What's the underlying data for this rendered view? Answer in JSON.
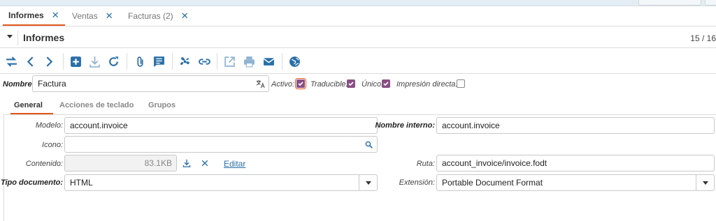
{
  "tabs": [
    {
      "label": "Informes",
      "active": true
    },
    {
      "label": "Ventas",
      "active": false
    },
    {
      "label": "Facturas (2)",
      "active": false
    }
  ],
  "titlebar": {
    "title": "Informes",
    "record_count": "15 / 16"
  },
  "toolbar": {
    "icons": [
      "switch-view-icon",
      "previous-icon",
      "next-icon",
      "new-record-icon",
      "save-icon",
      "reload-icon",
      "attachment-icon",
      "note-icon",
      "action-icon",
      "relate-icon",
      "open-external-icon",
      "print-icon",
      "email-icon",
      "globe-icon"
    ]
  },
  "header_fields": {
    "nombre_label": "Nombre:",
    "nombre_value": "Factura",
    "activo_label": "Activo:",
    "activo_checked": true,
    "traducible_label": "Traducible:",
    "traducible_checked": true,
    "unico_label": "Único:",
    "unico_checked": true,
    "impresion_label": "Impresión directa:",
    "impresion_checked": false
  },
  "form_tabs": [
    {
      "label": "General",
      "active": true
    },
    {
      "label": "Acciones de teclado",
      "active": false
    },
    {
      "label": "Grupos",
      "active": false
    }
  ],
  "general": {
    "modelo_label": "Modelo:",
    "modelo_value": "account.invoice",
    "nombre_interno_label": "Nombre interno:",
    "nombre_interno_value": "account.invoice",
    "icono_label": "Icono:",
    "icono_value": "",
    "contenido_label": "Contenido:",
    "contenido_value": "83.1KB",
    "editar_label": "Editar",
    "ruta_label": "Ruta:",
    "ruta_value": "account_invoice/invoice.fodt",
    "tipo_label": "Tipo documento:",
    "tipo_value": "HTML",
    "extension_label": "Extensión:",
    "extension_value": "Portable Document Format"
  },
  "colors": {
    "accent": "#e2561b",
    "link": "#2a6fa8",
    "checkbox": "#8a4f85",
    "toolbar_icon": "#2a6fa8"
  }
}
